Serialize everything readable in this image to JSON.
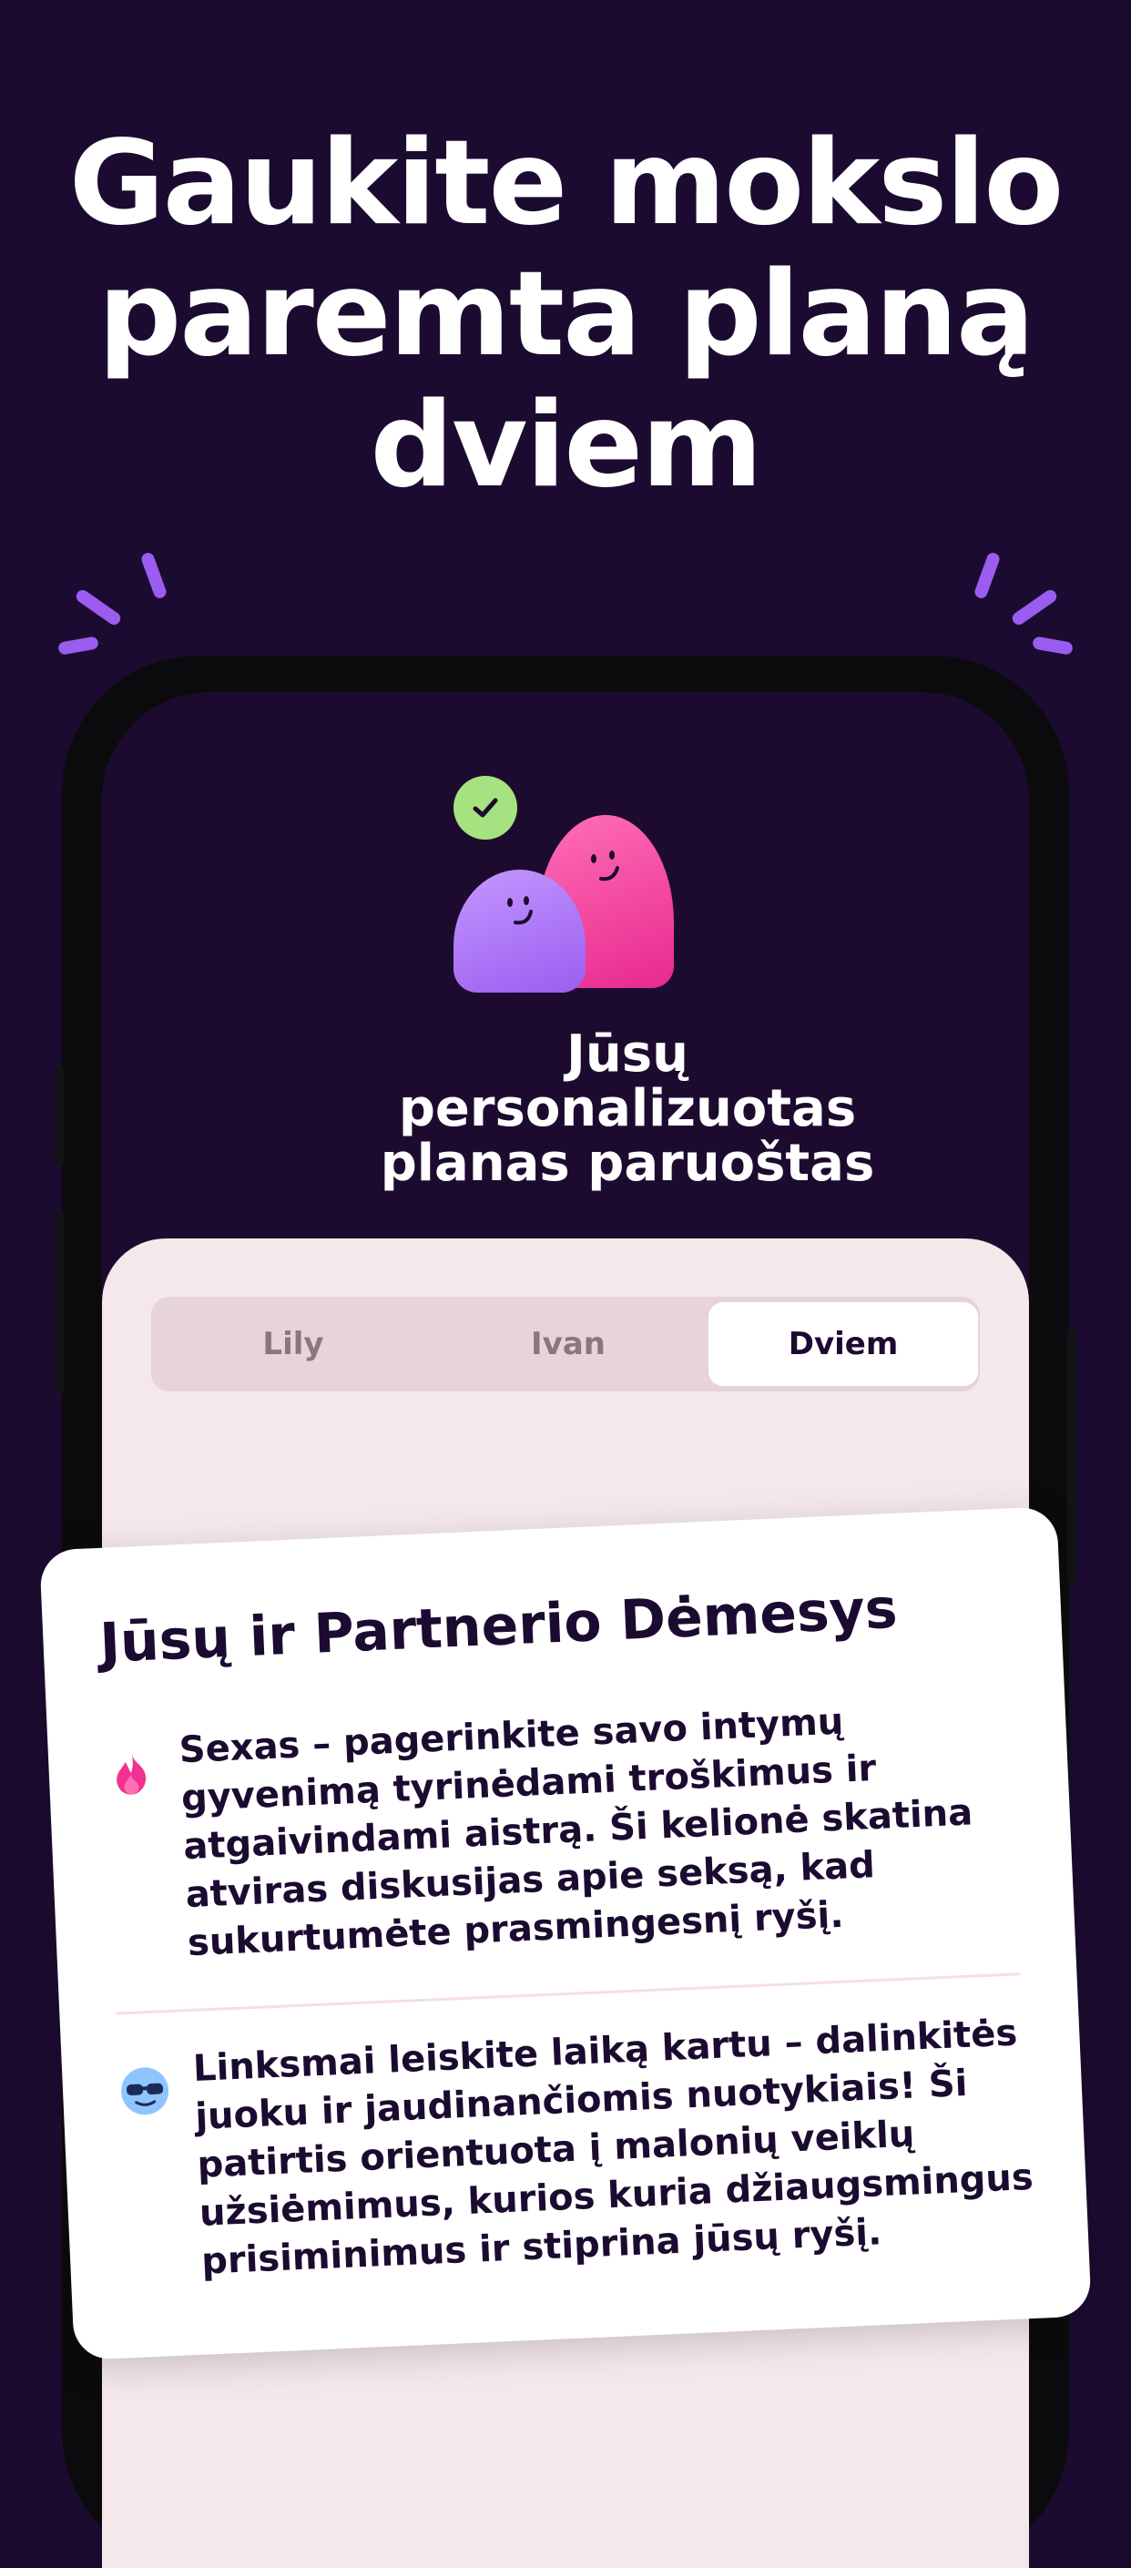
{
  "headline": {
    "line1": "Gaukite mokslo",
    "line2": "paremta planą",
    "line3": "dviem"
  },
  "colors": {
    "background": "#1c0b30",
    "accent_purple": "#9b5cf0",
    "accent_pink": "#e8298f",
    "check_green": "#a6e27f",
    "panel": "#f4e8ea"
  },
  "plan": {
    "title_line1": "Jūsų",
    "title_line2": "personalizuotas",
    "title_line3": "planas paruoštas"
  },
  "tabs": [
    {
      "label": "Lily",
      "active": false
    },
    {
      "label": "Ivan",
      "active": false
    },
    {
      "label": "Dviem",
      "active": true
    }
  ],
  "card": {
    "title": "Jūsų ir Partnerio Dėmesys",
    "items": [
      {
        "icon": "flame-icon",
        "lines": [
          "Sexas – pagerinkite savo intymų",
          "gyvenimą tyrinėdami troškimus ir",
          "atgaivindami aistrą. Ši kelionė skatina",
          "atviras diskusijas apie seksą, kad",
          "sukurtumėte prasmingesnį ryšį."
        ]
      },
      {
        "icon": "sunglasses-face-icon",
        "lines": [
          "Linksmai leiskite laiką kartu – dalinkitės",
          "juoku ir jaudinančiomis nuotykiais! Ši",
          "patirtis orientuota į malonių veiklų",
          "užsiėmimus, kurios kuria džiaugsmingus",
          "prisiminimus ir stiprina jūsų ryšį."
        ]
      }
    ]
  }
}
